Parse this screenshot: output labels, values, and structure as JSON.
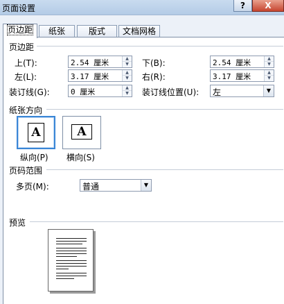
{
  "window": {
    "title": "页面设置",
    "help_label": "?",
    "close_label": "X"
  },
  "tabs": [
    {
      "label": "页边距",
      "active": true
    },
    {
      "label": "纸张",
      "active": false
    },
    {
      "label": "版式",
      "active": false
    },
    {
      "label": "文档网格",
      "active": false
    }
  ],
  "margins": {
    "section_title": "页边距",
    "top": {
      "label": "上(T):",
      "value": "2.54 厘米"
    },
    "bottom": {
      "label": "下(B):",
      "value": "2.54 厘米"
    },
    "left": {
      "label": "左(L):",
      "value": "3.17 厘米"
    },
    "right": {
      "label": "右(R):",
      "value": "3.17 厘米"
    },
    "gutter": {
      "label": "装订线(G):",
      "value": "0 厘米"
    },
    "gutter_position": {
      "label": "装订线位置(U):",
      "value": "左"
    }
  },
  "orientation": {
    "section_title": "纸张方向",
    "portrait_label": "纵向(P)",
    "landscape_label": "横向(S)",
    "glyph": "A",
    "selected": "portrait"
  },
  "pages": {
    "section_title": "页码范围",
    "multiple_label": "多页(M):",
    "multiple_value": "普通"
  },
  "preview": {
    "section_title": "预览"
  },
  "colors": {
    "accent": "#3a86d6",
    "window_bg": "#ecf1f8",
    "close": "#c6452f"
  }
}
